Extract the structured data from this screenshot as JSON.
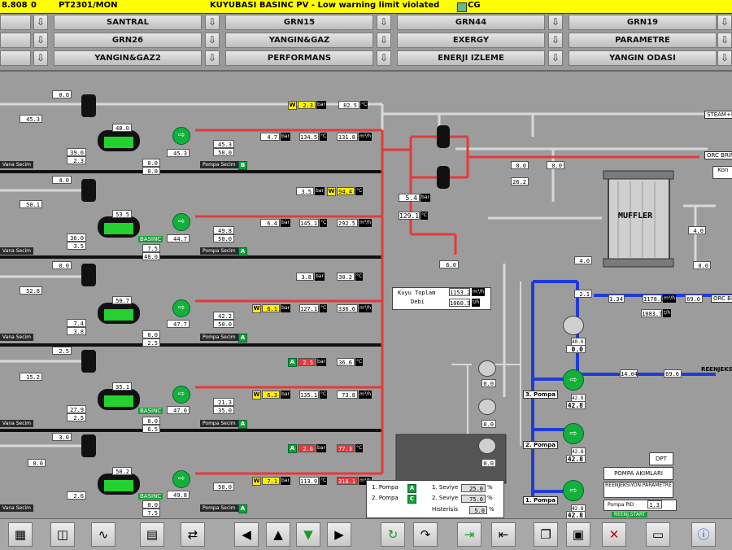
{
  "alarm_bar": {
    "value": "8.808",
    "code": "0",
    "tag": "PT2301/MON",
    "message": "KUYUBASI BASINC PV - Low warning limit violated",
    "flag": "CG"
  },
  "nav": {
    "row1": [
      "SANTRAL",
      "GRN15",
      "GRN44",
      "GRN19"
    ],
    "row2": [
      "GRN26",
      "YANGIN&GAZ",
      "EXERGY",
      "PARAMETRE"
    ],
    "row3": [
      "YANGIN&GAZ2",
      "PERFORMANS",
      "ENERJI IZLEME",
      "YANGIN ODASI"
    ]
  },
  "colors": {
    "hot_line": "#e43a3a",
    "cold_line": "#1f3bd6",
    "pump_green": "#13b13a",
    "alarm_yellow": "#ffff00"
  },
  "wells": [
    {
      "top_val": "0.0",
      "left_val": "45.3",
      "level": "48.0",
      "val2": "39.6",
      "val3": "2.3",
      "press": "45.3",
      "pct": "50.0",
      "press2": "45.3",
      "a": "0.0",
      "b": "0.0",
      "vana": "Vana Secim",
      "pompa": "Pompa Secim",
      "pompa_mode": "B",
      "badge_val": "2.3",
      "badge_unit": "bar",
      "t_val": "82.5",
      "t_unit": "°C",
      "p_val": "4.7",
      "p_unit": "bar",
      "temp": "134.5",
      "temp_unit": "°C",
      "flow": "131.8",
      "flow_unit": "m³/h"
    },
    {
      "top_val": "4.0",
      "left_val": "50.1",
      "level": "53.5",
      "val2": "36.0",
      "val3": "3.5",
      "press": "44.7",
      "pct": "50.0",
      "press2": "49.8",
      "a": "7.5",
      "b": "40.0",
      "vana": "Vana Secim",
      "pompa": "Pompa Secim",
      "pompa_mode": "A",
      "basinc": "BASINC",
      "badge_val": "94.4",
      "badge_unit": "°C",
      "t_val": "3.5",
      "t_unit": "bar",
      "p_val": "6.4",
      "p_unit": "bar",
      "temp": "145.1",
      "temp_unit": "°C",
      "flow": "292.5",
      "flow_unit": "m³/h"
    },
    {
      "top_val": "0.0",
      "left_val": "52.8",
      "level": "50.7",
      "val2": "7.4",
      "val3": "3.8",
      "press": "47.7",
      "pct": "50.0",
      "press2": "42.2",
      "a": "0.0",
      "b": "2.5",
      "vana": "Vana Secim",
      "pompa": "Pompa Secim",
      "pompa_mode": "A",
      "badge_val": "6.1",
      "badge_unit": "bar",
      "t_val": "3.8",
      "t_unit": "bar",
      "t2_val": "30.2",
      "t2_unit": "°C",
      "p_val": "6.1",
      "p_unit": "bar",
      "temp": "127.1",
      "temp_unit": "°C",
      "flow": "336.6",
      "flow_unit": "m³/h"
    },
    {
      "top_val": "2.5",
      "left_val": "15.2",
      "level": "35.1",
      "val2": "27.9",
      "val3": "2.5",
      "press": "47.0",
      "pct": "35.0",
      "press2": "21.3",
      "a": "0.0",
      "b": "6.5",
      "vana": "Vana Secim",
      "pompa": "Pompa Secim",
      "pompa_mode": "A",
      "basinc": "BASINC",
      "badge_val": "2.5",
      "badge_unit": "bar",
      "t_val": "36.6",
      "t_unit": "°C",
      "p_val": "6.3",
      "p_unit": "bar",
      "temp": "135.1",
      "temp_unit": "°C",
      "flow": "73.8",
      "flow_unit": "m³/h"
    },
    {
      "top_val": "3.0",
      "left_val": "0.0",
      "level": "50.2",
      "val2": "0.0",
      "val3": "2.6",
      "press": "49.8",
      "pct": "50.0",
      "press2": "",
      "a": "0.0",
      "b": "7.5",
      "vana": "Vana Secim",
      "pompa": "Pompa Secim",
      "pompa_mode": "A",
      "basinc": "BASINC",
      "badge_val": "2.6",
      "badge_unit": "bar",
      "t_val": "77.3",
      "t_unit": "°C",
      "p_val": "7.1",
      "p_unit": "bar",
      "temp": "113.9",
      "temp_unit": "°C",
      "flow": "318.1",
      "flow_unit": "m³/h"
    }
  ],
  "header_flow": {
    "steam": "STEAM+NCG",
    "orc": "ORC BRINE",
    "orc2": "ORC BR",
    "kon": "Kon",
    "p1": "0.0",
    "p2": "0.0",
    "p3": "26.2",
    "sep_press": "5.4",
    "sep_press_unit": "bar",
    "sep_temp": "129.1",
    "sep_temp_unit": "°C",
    "v1": "0.0",
    "v2": "6.0"
  },
  "muffler": {
    "label": "MUFFLER",
    "right_val": "4.0",
    "right_val2": "0.0",
    "left_val": "4.0"
  },
  "kuyu_toplam": {
    "label1": "Kuyu Toplam",
    "label2": "Debi",
    "val1": "1153.2",
    "unit1": "m³/h",
    "val2": "1060.9",
    "unit2": "t/h"
  },
  "reinjection": {
    "v_top": "2.1",
    "flow1": "1.34",
    "flow2": "1178.0",
    "flow2_unit": "m³/h",
    "v_orc": "69.0",
    "total": "1083.7",
    "total_unit": "t/h",
    "label": "REENJEKSIYON",
    "line_val": "14.04",
    "line_val2": "69.6",
    "pump1_val": "40.0",
    "pump1_big": "0.0",
    "pump2_val": "42.8",
    "pump2_big": "42.8",
    "pump3_val": "42.8",
    "pump3_big": "42.8",
    "pump4_val": "42.8",
    "pump4_big": "42.8",
    "pump_labels": [
      "3. Pompa",
      "2. Pompa",
      "1. Pompa"
    ],
    "small_pumps": [
      "0.0",
      "0.0",
      "0.0"
    ],
    "dpt": "DPT",
    "pompa_akim": "POMPA AKIMLARI",
    "param": "REENJEKSIYON PARAMETRE",
    "pid_label": "Pompa PID",
    "pid_val": "1.3",
    "start": "REENJ.START"
  },
  "level_panel": {
    "row1_label": "1. Pompa",
    "row1_state": "A",
    "row2_label": "2. Pompa",
    "row2_state": "C",
    "s1_label": "1. Seviye",
    "s1_val": "25.0",
    "s2_label": "2. Seviye",
    "s2_val": "75.0",
    "hist_label": "Histerisis",
    "hist_val": "5.0",
    "pct_unit": "%"
  },
  "toolbar": {
    "icons": [
      "overview-icon",
      "trend-tag-icon",
      "trend-icon",
      "report-icon",
      "export-icon",
      "back-icon",
      "up-icon",
      "down-icon",
      "forward-icon",
      "refresh-icon",
      "redo-icon",
      "login-icon",
      "logout-icon",
      "copy-icon",
      "save-icon",
      "delete-icon",
      "monitor-icon",
      "help-icon"
    ]
  }
}
